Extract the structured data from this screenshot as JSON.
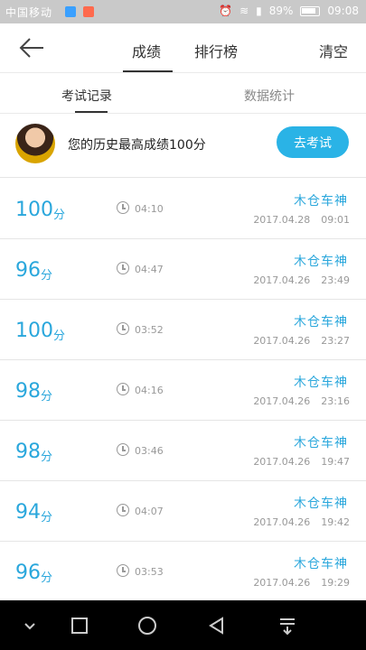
{
  "status_bar": {
    "carrier": "中国移动",
    "battery": "89%",
    "time": "09:08"
  },
  "header": {
    "tabs": [
      "成绩",
      "排行榜"
    ],
    "clear_label": "清空"
  },
  "sub_tabs": [
    "考试记录",
    "数据统计"
  ],
  "banner": {
    "best_text": "您的历史最高成绩100分",
    "button_label": "去考试"
  },
  "records": [
    {
      "score": "100",
      "unit": "分",
      "duration": "04:10",
      "player": "木仓车神",
      "date": "2017.04.28",
      "time": "09:01"
    },
    {
      "score": "96",
      "unit": "分",
      "duration": "04:47",
      "player": "木仓车神",
      "date": "2017.04.26",
      "time": "23:49"
    },
    {
      "score": "100",
      "unit": "分",
      "duration": "03:52",
      "player": "木仓车神",
      "date": "2017.04.26",
      "time": "23:27"
    },
    {
      "score": "98",
      "unit": "分",
      "duration": "04:16",
      "player": "木仓车神",
      "date": "2017.04.26",
      "time": "23:16"
    },
    {
      "score": "98",
      "unit": "分",
      "duration": "03:46",
      "player": "木仓车神",
      "date": "2017.04.26",
      "time": "19:47"
    },
    {
      "score": "94",
      "unit": "分",
      "duration": "04:07",
      "player": "木仓车神",
      "date": "2017.04.26",
      "time": "19:42"
    },
    {
      "score": "96",
      "unit": "分",
      "duration": "03:53",
      "player": "木仓车神",
      "date": "2017.04.26",
      "time": "19:29"
    }
  ]
}
